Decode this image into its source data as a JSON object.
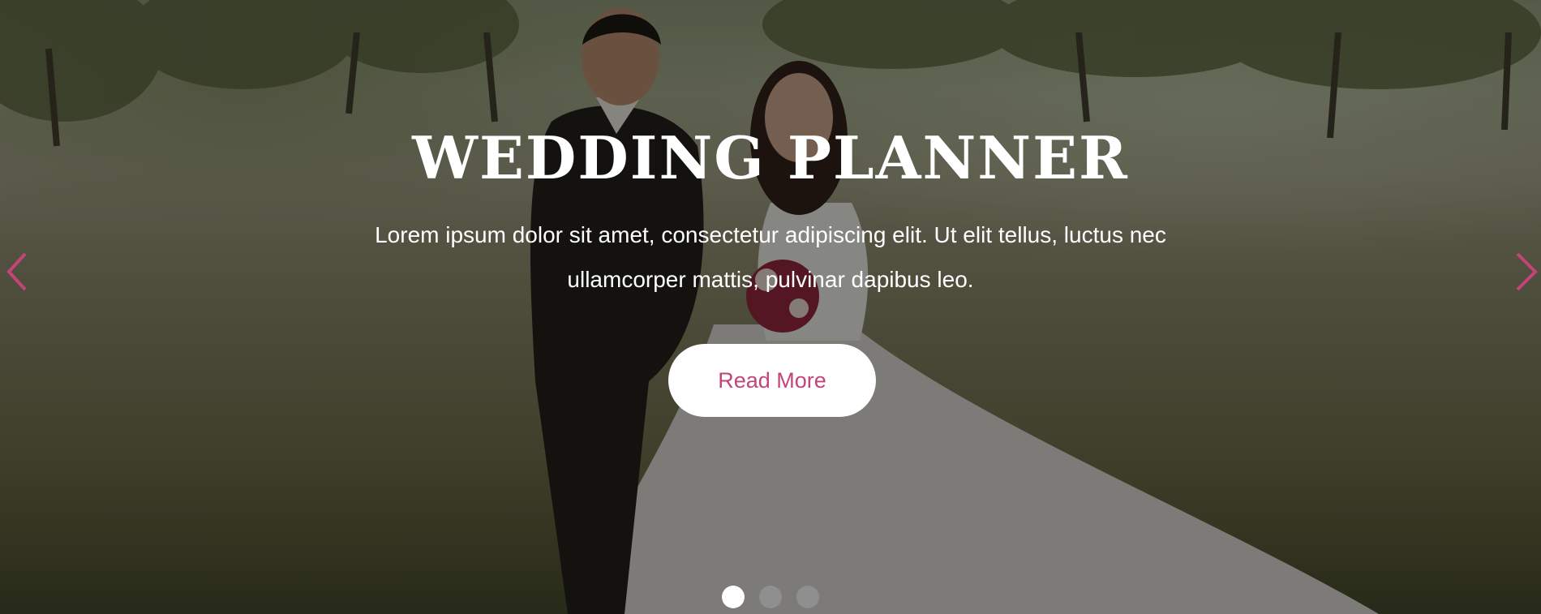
{
  "slider": {
    "title": "WEDDING PLANNER",
    "description": "Lorem ipsum dolor sit amet, consectetur adipiscing elit. Ut elit tellus, luctus nec ullamcorper mattis, pulvinar dapibus leo.",
    "button_label": "Read More",
    "prev_icon": "chevron-left-icon",
    "next_icon": "chevron-right-icon",
    "slide_count": 3,
    "active_slide": 1
  },
  "colors": {
    "accent": "#c2447a",
    "overlay": "rgba(10,10,6,0.45)",
    "dot_active": "#ffffff",
    "dot_inactive": "#8f8f8f"
  }
}
